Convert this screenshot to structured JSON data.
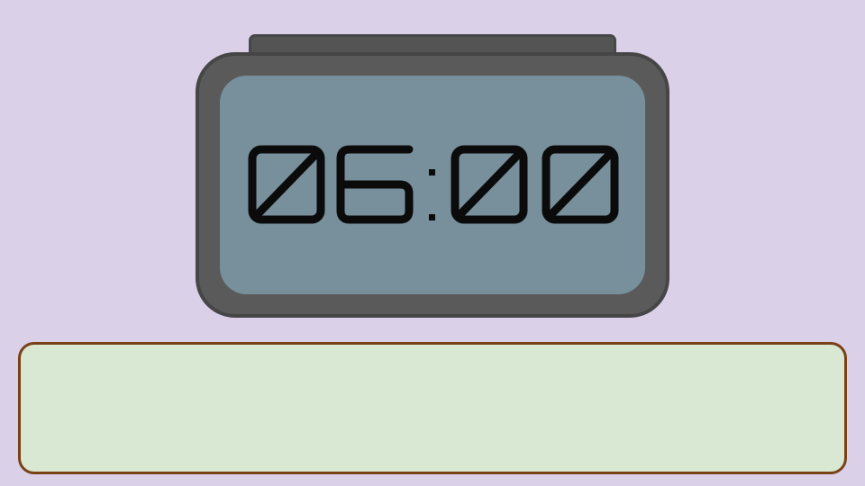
{
  "clock": {
    "time_display": "06:00",
    "hours": "06",
    "minutes": "00",
    "digit_color": "#0b0b0b",
    "screen_color": "#78909c",
    "body_color": "#5a5a5a"
  },
  "answer_panel": {
    "text": ""
  },
  "colors": {
    "background": "#dad0e8",
    "panel_fill": "#d9e8d3",
    "panel_border": "#7a4117"
  }
}
